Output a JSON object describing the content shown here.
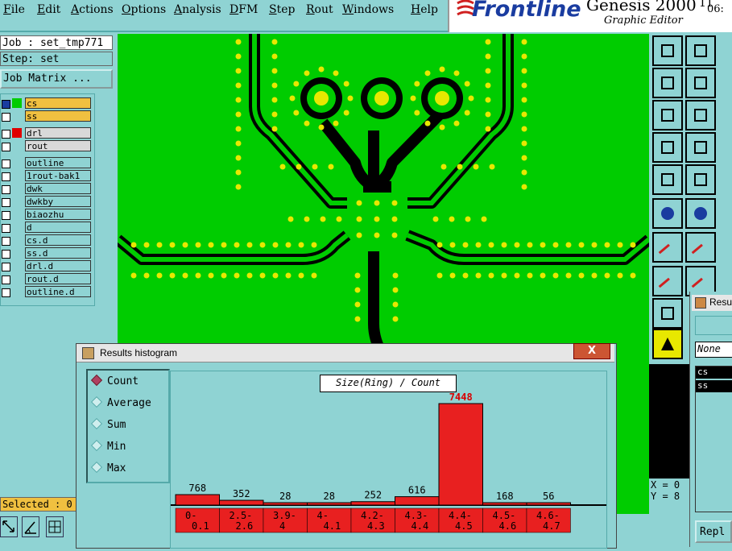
{
  "menu": {
    "items": [
      "File",
      "Edit",
      "Actions",
      "Options",
      "Analysis",
      "DFM",
      "Step",
      "Rout",
      "Windows",
      "Help"
    ]
  },
  "brand": {
    "name": "Frontline",
    "product": "Genesis 2000",
    "subtitle": "Graphic Editor",
    "clock": "06:",
    "version_fragment": "11"
  },
  "job": {
    "job_label": "Job : set_tmp771",
    "step_label": "Step: set",
    "matrix_button": "Job Matrix ..."
  },
  "layers": [
    {
      "name": "cs",
      "color": "#00cc00",
      "highlight": "#f0c040",
      "active": true
    },
    {
      "name": "ss",
      "color": "#8fd3d3",
      "highlight": "#f0c040",
      "active": false
    },
    {
      "name": "drl",
      "color": "#e00000",
      "highlight": "#d9d9d9",
      "active": false
    },
    {
      "name": "rout",
      "color": "#8fd3d3",
      "highlight": "#d9d9d9",
      "active": false
    },
    {
      "name": "outline",
      "color": "#8fd3d3",
      "highlight": "#8fd3d3",
      "active": false
    },
    {
      "name": "1rout-bak1",
      "color": "#8fd3d3",
      "highlight": "#8fd3d3",
      "active": false
    },
    {
      "name": "dwk",
      "color": "#8fd3d3",
      "highlight": "#8fd3d3",
      "active": false
    },
    {
      "name": "dwkby",
      "color": "#8fd3d3",
      "highlight": "#8fd3d3",
      "active": false
    },
    {
      "name": "biaozhu",
      "color": "#8fd3d3",
      "highlight": "#8fd3d3",
      "active": false
    },
    {
      "name": "d",
      "color": "#8fd3d3",
      "highlight": "#8fd3d3",
      "active": false
    },
    {
      "name": "cs.d",
      "color": "#8fd3d3",
      "highlight": "#8fd3d3",
      "active": false
    },
    {
      "name": "ss.d",
      "color": "#8fd3d3",
      "highlight": "#8fd3d3",
      "active": false
    },
    {
      "name": "drl.d",
      "color": "#8fd3d3",
      "highlight": "#8fd3d3",
      "active": false
    },
    {
      "name": "rout.d",
      "color": "#8fd3d3",
      "highlight": "#8fd3d3",
      "active": false
    },
    {
      "name": "outline.d",
      "color": "#8fd3d3",
      "highlight": "#8fd3d3",
      "active": false
    }
  ],
  "status": {
    "selected": "Selected : 0",
    "coord_x": "X = 0",
    "coord_y": "Y = 8"
  },
  "histogram": {
    "window_title": "Results histogram",
    "close_label": "X",
    "modes": [
      {
        "label": "Count",
        "selected": true
      },
      {
        "label": "Average",
        "selected": false
      },
      {
        "label": "Sum",
        "selected": false
      },
      {
        "label": "Min",
        "selected": false
      },
      {
        "label": "Max",
        "selected": false
      }
    ]
  },
  "chart_data": {
    "type": "bar",
    "title": "Size(Ring) / Count",
    "categories": [
      "0-\n0.1",
      "2.5-\n2.6",
      "3.9-\n4",
      "4-\n4.1",
      "4.2-\n4.3",
      "4.3-\n4.4",
      "4.4-\n4.5",
      "4.5-\n4.6",
      "4.6-\n4.7"
    ],
    "values": [
      768,
      352,
      28,
      28,
      252,
      616,
      7448,
      168,
      56
    ],
    "bar_color": "#e82020",
    "highlight_color": "#d80000"
  },
  "results_panel": {
    "title": "Resu",
    "none_label": "None",
    "items": [
      "cs",
      "ss"
    ],
    "button": "Repl"
  }
}
